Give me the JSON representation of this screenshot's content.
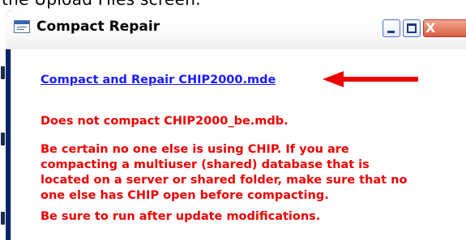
{
  "document": {
    "partial_text": "the Upload Files screen."
  },
  "window": {
    "title": "Compact Repair",
    "icon": "form-icon",
    "controls": {
      "minimize_icon": "minimize-icon",
      "maximize_icon": "maximize-icon",
      "close_icon": "close-icon",
      "close_glyph": "X"
    }
  },
  "content": {
    "link_label": "Compact and Repair CHIP2000.mde",
    "arrow_icon": "red-arrow-icon",
    "messages": [
      [
        "Does not compact CHIP2000_be.mdb."
      ],
      [
        "Be certain no one else is using CHIP. If you are",
        "compacting a multiuser (shared) database that is",
        "located on a server or shared folder, make sure that no",
        "one else has CHIP open before compacting."
      ],
      [
        "Be sure to run after update modifications."
      ]
    ]
  },
  "colors": {
    "title_bar_border": "#0a246a",
    "link": "#1a1aff",
    "message_text": "#ee0000",
    "arrow": "#ee0000"
  }
}
